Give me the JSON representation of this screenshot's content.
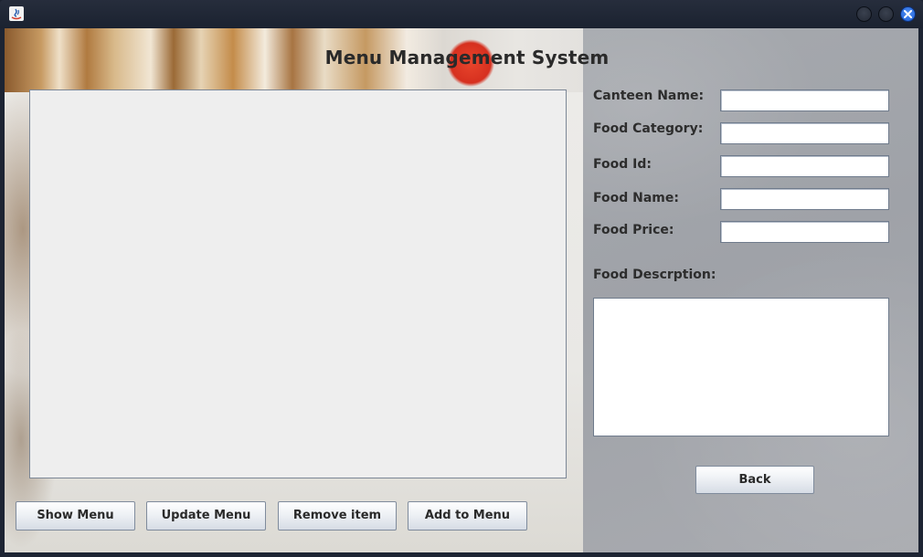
{
  "window": {
    "controls": [
      "minimize",
      "maximize",
      "close"
    ]
  },
  "page": {
    "title": "Menu Management System"
  },
  "menu_table": {
    "rows": []
  },
  "buttons": {
    "show_menu": "Show Menu",
    "update_menu": "Update Menu",
    "remove_item": "Remove item",
    "add_to_menu": "Add to Menu",
    "back": "Back"
  },
  "form": {
    "canteen_name": {
      "label": "Canteen Name:",
      "value": ""
    },
    "food_category": {
      "label": "Food Category:",
      "value": ""
    },
    "food_id": {
      "label": "Food Id:",
      "value": ""
    },
    "food_name": {
      "label": "Food Name:",
      "value": ""
    },
    "food_price": {
      "label": "Food Price:",
      "value": ""
    },
    "food_description": {
      "label": "Food Descrption:",
      "value": ""
    }
  },
  "icons": {
    "app": "java-app-icon",
    "close": "close-icon"
  },
  "colors": {
    "titlebar": "#1d2433",
    "close_button": "#1d5fd6",
    "right_panel": "#a3a6ab",
    "table_background": "#eeeeee"
  }
}
